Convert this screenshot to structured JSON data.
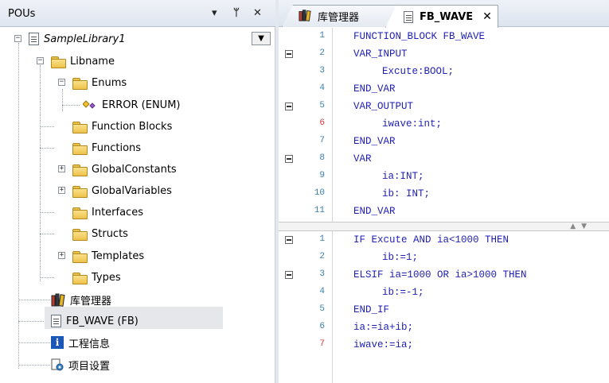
{
  "pou_panel": {
    "title": "POUs",
    "buttons": {
      "dropdown": "▾",
      "pin": "ᛘ",
      "close": "✕"
    },
    "tree": [
      {
        "id": "sample_library",
        "label": "SampleLibrary1"
      },
      {
        "id": "libname",
        "label": "Libname"
      },
      {
        "id": "enums",
        "label": "Enums"
      },
      {
        "id": "error_enum",
        "label": "ERROR (ENUM)"
      },
      {
        "id": "function_blocks",
        "label": "Function Blocks"
      },
      {
        "id": "functions",
        "label": "Functions"
      },
      {
        "id": "global_constants",
        "label": "GlobalConstants"
      },
      {
        "id": "global_variables",
        "label": "GlobalVariables"
      },
      {
        "id": "interfaces",
        "label": "Interfaces"
      },
      {
        "id": "structs",
        "label": "Structs"
      },
      {
        "id": "templates",
        "label": "Templates"
      },
      {
        "id": "types",
        "label": "Types"
      },
      {
        "id": "library_manager",
        "label": "库管理器"
      },
      {
        "id": "fb_wave",
        "label": "FB_WAVE (FB)"
      },
      {
        "id": "project_info",
        "label": "工程信息"
      },
      {
        "id": "project_settings",
        "label": "项目设置"
      }
    ]
  },
  "editor": {
    "tabs": [
      {
        "id": "lib",
        "label": "库管理器",
        "icon": "library-icon"
      },
      {
        "id": "fbwave",
        "label": "FB_WAVE",
        "icon": "document-icon",
        "close": "✕"
      }
    ],
    "declaration": {
      "lines": [
        {
          "n": "1",
          "text": "FUNCTION_BLOCK FB_WAVE"
        },
        {
          "n": "2",
          "text": "VAR_INPUT"
        },
        {
          "n": "3",
          "text": "Excute:BOOL;"
        },
        {
          "n": "4",
          "text": "END_VAR"
        },
        {
          "n": "5",
          "text": "VAR_OUTPUT"
        },
        {
          "n": "6",
          "text": "iwave:int;"
        },
        {
          "n": "7",
          "text": "END_VAR"
        },
        {
          "n": "8",
          "text": "VAR"
        },
        {
          "n": "9",
          "text": "ia:INT;"
        },
        {
          "n": "10",
          "text": "ib: INT;"
        },
        {
          "n": "11",
          "text": "END_VAR"
        }
      ]
    },
    "implementation": {
      "lines": [
        {
          "n": "1",
          "text": "IF Excute AND ia<1000 THEN"
        },
        {
          "n": "2",
          "text": "ib:=1;"
        },
        {
          "n": "3",
          "text": "ELSIF ia=1000 OR ia>1000 THEN"
        },
        {
          "n": "4",
          "text": "ib:=-1;"
        },
        {
          "n": "5",
          "text": "END_IF"
        },
        {
          "n": "6",
          "text": "ia:=ia+ib;"
        },
        {
          "n": "7",
          "text": "iwave:=ia;"
        }
      ]
    }
  },
  "colors": {
    "keyword": "#1f1fb4",
    "line_number": "#3a7fb1",
    "line_number_modified": "#d43a3a",
    "selected_row": "#e5e7eb",
    "folder": "#eec24c"
  }
}
